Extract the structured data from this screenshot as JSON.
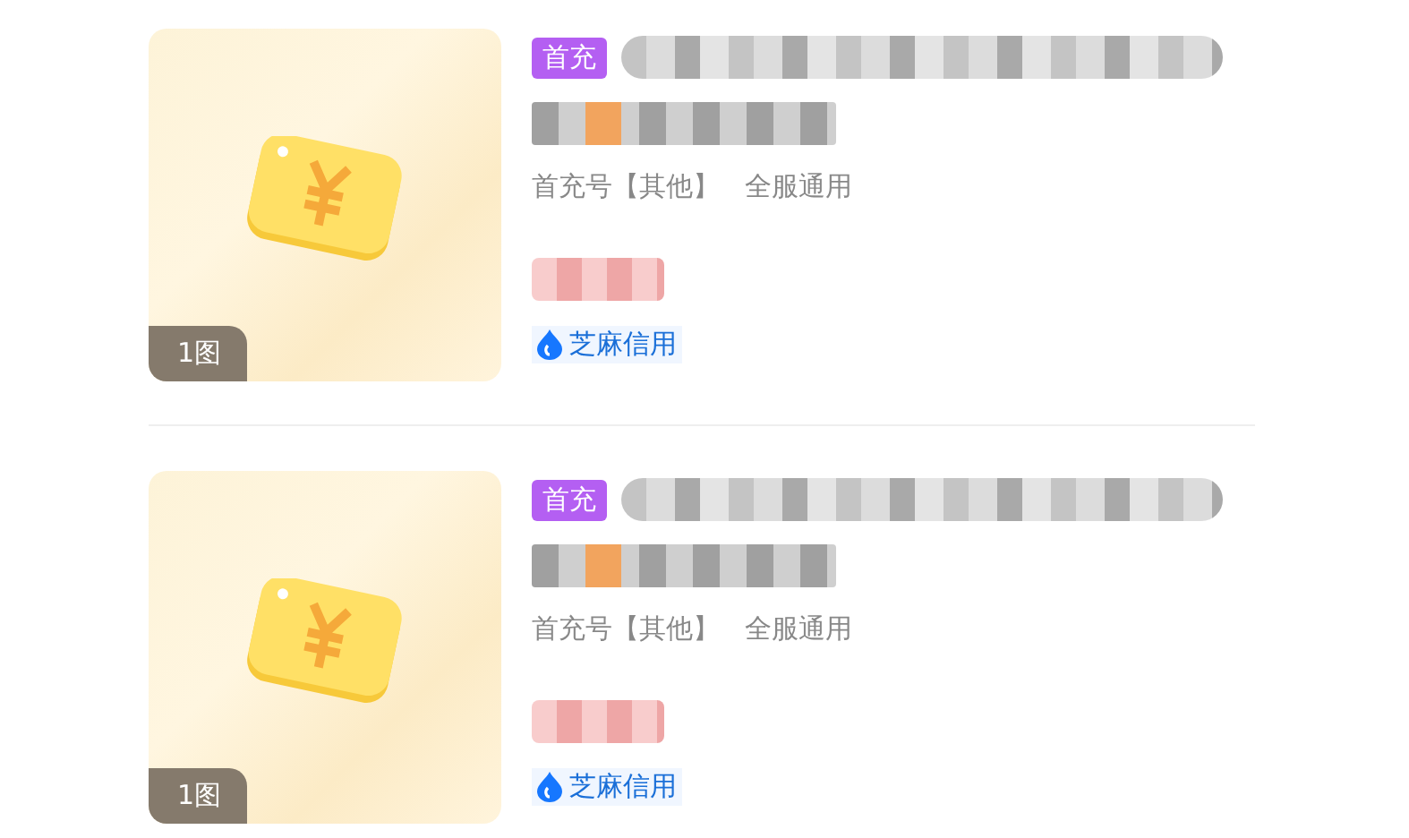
{
  "listings": [
    {
      "image_count": "1图",
      "tag": "首充",
      "attributes": [
        "首充号【其他】",
        "全服通用"
      ],
      "credit": "芝麻信用"
    },
    {
      "image_count": "1图",
      "tag": "首充",
      "attributes": [
        "首充号【其他】",
        "全服通用"
      ],
      "credit": "芝麻信用"
    }
  ]
}
